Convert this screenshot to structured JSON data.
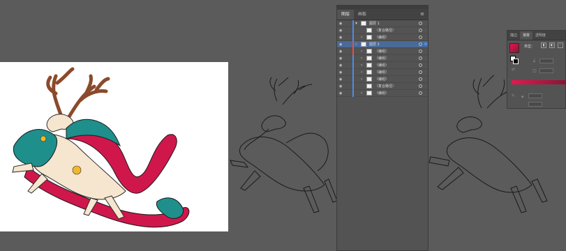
{
  "layers_panel": {
    "tabs": [
      {
        "label": "图层"
      },
      {
        "label": "画板"
      }
    ],
    "rows": [
      {
        "name": "图层 1",
        "chevron": "▾",
        "bar": "#4c8ce8",
        "indent": 0,
        "selected": false
      },
      {
        "name": "〈复合路径〉",
        "chevron": "",
        "bar": "#4c8ce8",
        "indent": 1,
        "selected": false
      },
      {
        "name": "〈编组〉",
        "chevron": "›",
        "bar": "#4c8ce8",
        "indent": 1,
        "selected": false
      },
      {
        "name": "图层 2",
        "chevron": "›",
        "bar": "#e0524c",
        "indent": 0,
        "selected": true
      },
      {
        "name": "〈编组〉",
        "chevron": "›",
        "bar": "#e0524c",
        "indent": 1,
        "selected": false
      },
      {
        "name": "〈编组〉",
        "chevron": "›",
        "bar": "#4c8ce8",
        "indent": 1,
        "selected": false
      },
      {
        "name": "〈编组〉",
        "chevron": "›",
        "bar": "#4c8ce8",
        "indent": 1,
        "selected": false
      },
      {
        "name": "〈编组〉",
        "chevron": "›",
        "bar": "#4c8ce8",
        "indent": 1,
        "selected": false
      },
      {
        "name": "〈编组〉",
        "chevron": "›",
        "bar": "#4c8ce8",
        "indent": 1,
        "selected": false
      },
      {
        "name": "〈复合路径〉",
        "chevron": "",
        "bar": "#4c8ce8",
        "indent": 1,
        "selected": false
      },
      {
        "name": "〈编组〉",
        "chevron": "›",
        "bar": "#4c8ce8",
        "indent": 1,
        "selected": false
      }
    ]
  },
  "gradient_panel": {
    "tabs": [
      {
        "label": "描边"
      },
      {
        "label": "渐变"
      },
      {
        "label": "透明度"
      }
    ],
    "type_label": "类型：",
    "gradient_start": "#e8174f",
    "gradient_end": "#8a1437"
  },
  "colors": {
    "canvas": "#5b5b5b",
    "teal": "#1f8f8c",
    "crimson": "#d0174c",
    "antler": "#8b4a2b"
  }
}
